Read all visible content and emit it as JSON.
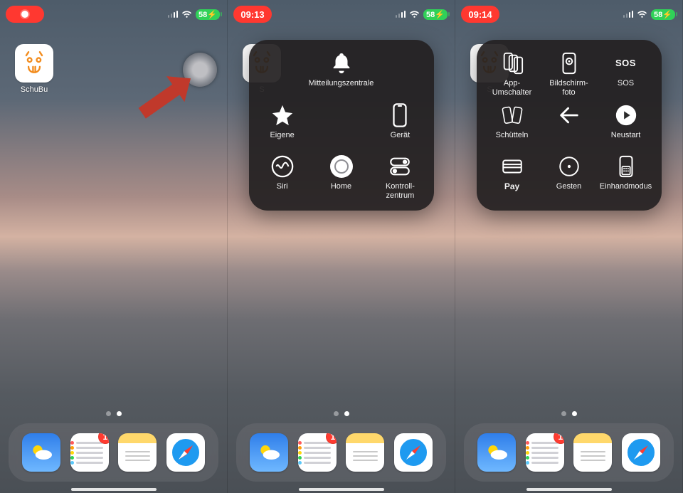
{
  "status": {
    "time_panel2": "09:13",
    "time_panel3": "09:14",
    "battery": "58"
  },
  "home": {
    "app_label": "SchuBu"
  },
  "dock": {
    "badge": "1"
  },
  "menu1": {
    "notification_center": "Mitteilungszentrale",
    "custom": "Eigene",
    "device": "Gerät",
    "siri": "Siri",
    "home": "Home",
    "control_center": "Kontroll-\nzentrum"
  },
  "menu2": {
    "app_switcher": "App-\nUmschalter",
    "screenshot": "Bildschirm-\nfoto",
    "sos": "SOS",
    "shake": "Schütteln",
    "restart": "Neustart",
    "apple_pay": "Pay",
    "gestures": "Gesten",
    "one_hand": "Einhandmodus"
  }
}
